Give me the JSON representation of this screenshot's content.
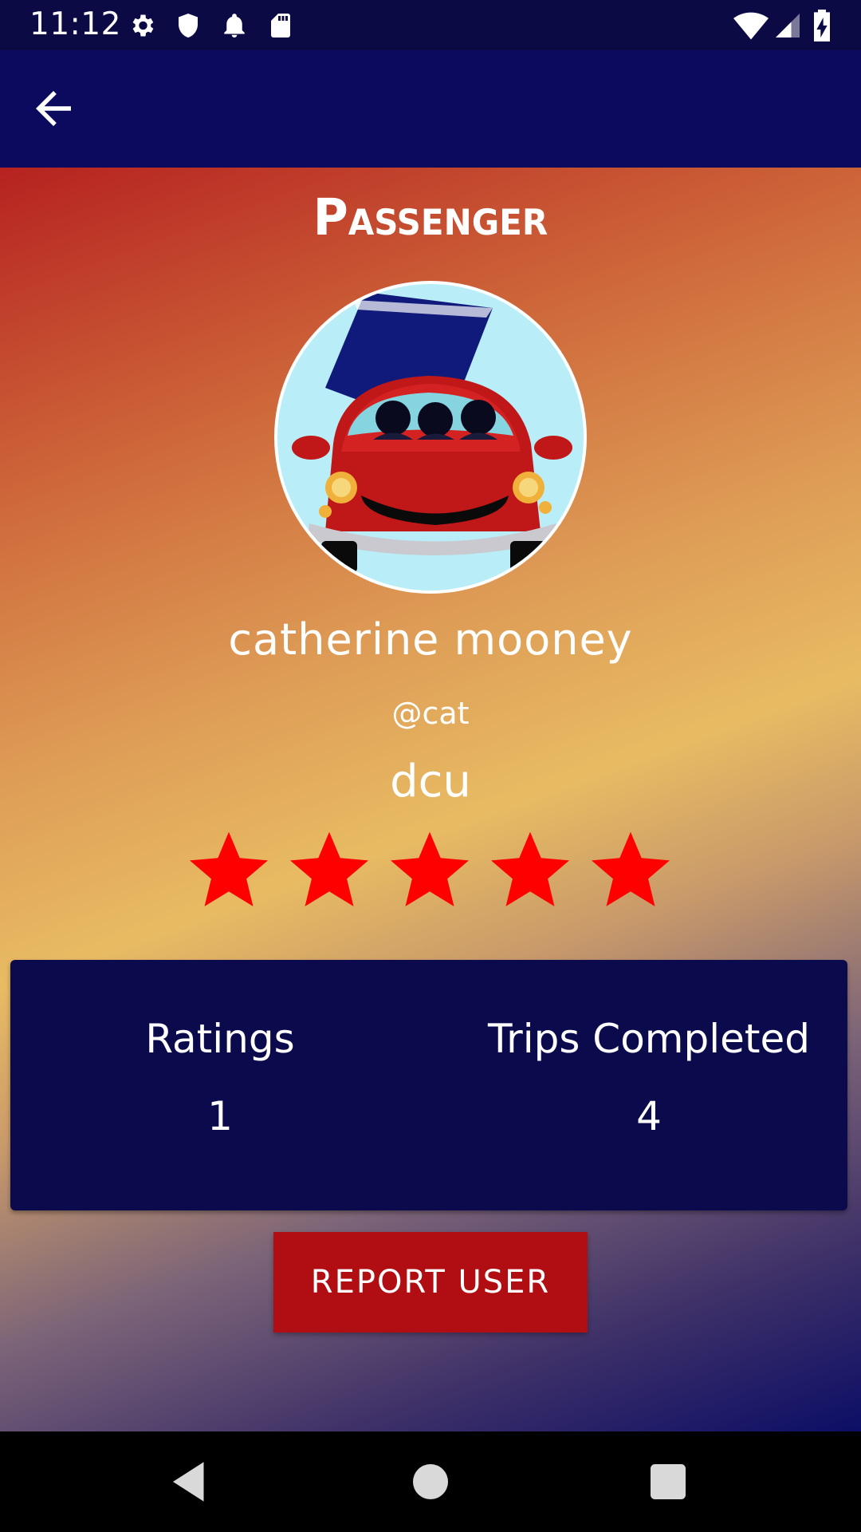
{
  "status_bar": {
    "time": "11:12",
    "icons_left": [
      "gear-icon",
      "shield-icon",
      "bell-icon",
      "sd-card-icon"
    ],
    "icons_right": [
      "wifi-icon",
      "signal-icon",
      "battery-charging-icon"
    ]
  },
  "app_bar": {
    "back_icon": "arrow-left-icon"
  },
  "profile": {
    "heading": "Passenger",
    "full_name": "catherine mooney",
    "username": "@cat",
    "affiliation": "dcu",
    "rating_stars": 5,
    "rating_max": 5,
    "star_color": "#ff0000"
  },
  "stats": {
    "ratings_label": "Ratings",
    "ratings_value": "1",
    "trips_label": "Trips Completed",
    "trips_value": "4"
  },
  "actions": {
    "report_label": "REPORT USER"
  },
  "nav_bar": {
    "icons": [
      "back-triangle-icon",
      "home-circle-icon",
      "recents-square-icon"
    ]
  },
  "colors": {
    "app_bar": "#0b0a5e",
    "stats_card": "#0b0a4d",
    "report_button": "#b10e13"
  }
}
